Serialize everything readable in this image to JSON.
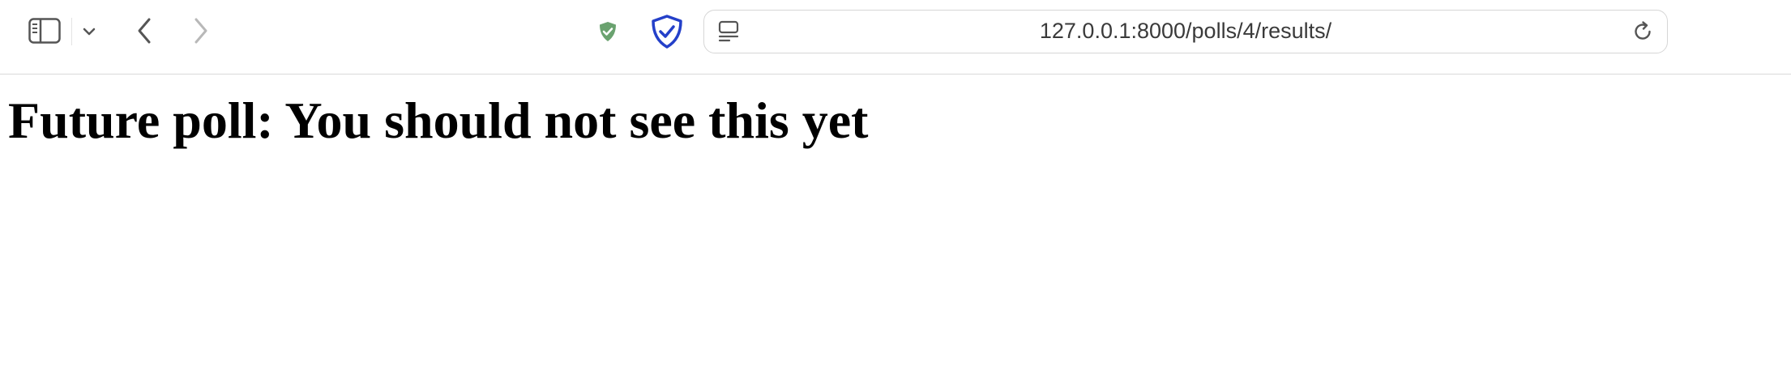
{
  "browser": {
    "address_bar": {
      "url": "127.0.0.1:8000/polls/4/results/"
    },
    "icons": {
      "sidebar": "sidebar-icon",
      "sidebar_menu": "chevron-down-icon",
      "back": "back-arrow-icon",
      "forward": "forward-arrow-icon",
      "extension_1": "green-shield-check-icon",
      "extension_2": "blue-shield-check-icon",
      "page_menu": "page-menu-icon",
      "reload": "reload-icon"
    },
    "colors": {
      "extension_green": "#6aa26f",
      "extension_blue": "#2440c9",
      "forward_disabled": "#b8b8b8",
      "icon_gray": "#555555"
    }
  },
  "page": {
    "heading": "Future poll: You should not see this yet"
  }
}
